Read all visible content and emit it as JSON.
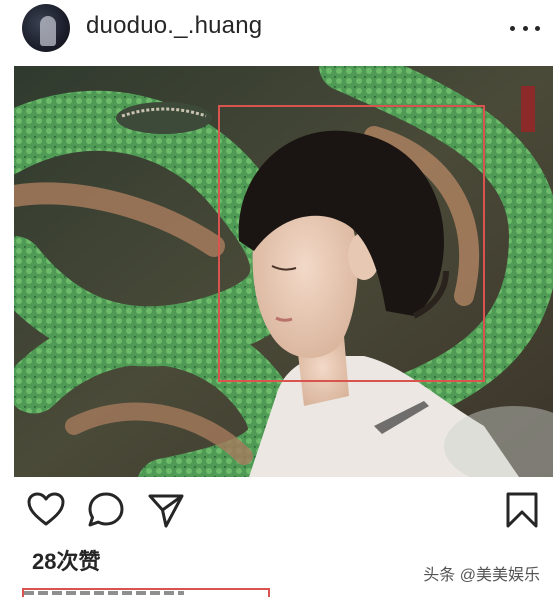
{
  "post": {
    "username": "duoduo._.huang",
    "likes_text": "28次赞"
  },
  "watermark": {
    "text": "头条 @美美娱乐"
  },
  "icons": {
    "more": "more-dots-icon",
    "like": "heart-icon",
    "comment": "comment-bubble-icon",
    "share": "send-paper-plane-icon",
    "save": "bookmark-icon"
  },
  "colors": {
    "text": "#262626",
    "highlight_box": "#d9534f",
    "serpent_green": "#4f9a55"
  }
}
